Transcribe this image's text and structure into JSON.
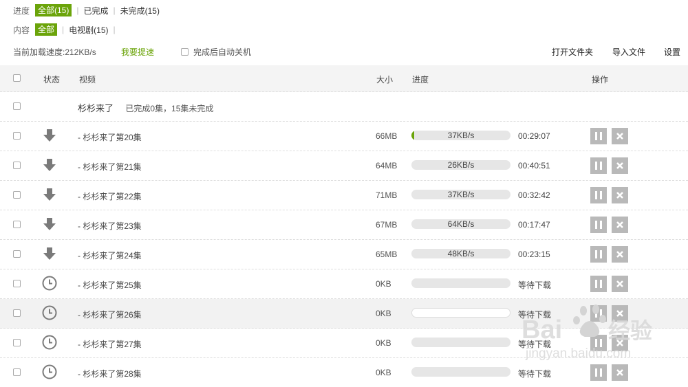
{
  "filters": {
    "progress": {
      "label": "进度",
      "all": "全部(15)",
      "done": "已完成",
      "undone": "未完成(15)"
    },
    "content": {
      "label": "内容",
      "all": "全部",
      "tv": "电视剧(15)"
    }
  },
  "toolbar": {
    "speed_text": "当前加载速度:212KB/s",
    "boost": "我要提速",
    "auto_shutdown": "完成后自动关机",
    "open_folder": "打开文件夹",
    "import_file": "导入文件",
    "settings": "设置"
  },
  "table": {
    "headers": {
      "status": "状态",
      "video": "视频",
      "size": "大小",
      "progress": "进度",
      "action": "操作"
    },
    "group": {
      "name": "杉杉来了",
      "summary": "已完成0集，15集未完成"
    },
    "rows": [
      {
        "name": "- 杉杉来了第20集",
        "size": "66MB",
        "progress_text": "37KB/s",
        "eta": "00:29:07",
        "status": "downloading-arrow-icon",
        "progress": 0.02
      },
      {
        "name": "- 杉杉来了第21集",
        "size": "64MB",
        "progress_text": "26KB/s",
        "eta": "00:40:51",
        "status": "downloading-arrow-icon",
        "progress": 0
      },
      {
        "name": "- 杉杉来了第22集",
        "size": "71MB",
        "progress_text": "37KB/s",
        "eta": "00:32:42",
        "status": "downloading-arrow-icon",
        "progress": 0
      },
      {
        "name": "- 杉杉来了第23集",
        "size": "67MB",
        "progress_text": "64KB/s",
        "eta": "00:17:47",
        "status": "downloading-arrow-icon",
        "progress": 0
      },
      {
        "name": "- 杉杉来了第24集",
        "size": "65MB",
        "progress_text": "48KB/s",
        "eta": "00:23:15",
        "status": "downloading-arrow-icon",
        "progress": 0
      },
      {
        "name": "- 杉杉来了第25集",
        "size": "0KB",
        "progress_text": "",
        "eta": "等待下载",
        "status": "clock-icon",
        "progress": 0
      },
      {
        "name": "- 杉杉来了第26集",
        "size": "0KB",
        "progress_text": "",
        "eta": "等待下载",
        "status": "clock-icon",
        "progress": 0
      },
      {
        "name": "- 杉杉来了第27集",
        "size": "0KB",
        "progress_text": "",
        "eta": "等待下载",
        "status": "clock-icon",
        "progress": 0
      },
      {
        "name": "- 杉杉来了第28集",
        "size": "0KB",
        "progress_text": "",
        "eta": "等待下载",
        "status": "clock-icon",
        "progress": 0
      }
    ]
  },
  "watermark": {
    "text": "Baidu经验",
    "sub": "jingyan.baidu.com"
  },
  "colors": {
    "accent": "#6ba40a",
    "button_gray": "#b9b9b9",
    "icon_gray": "#7a7a7a"
  }
}
